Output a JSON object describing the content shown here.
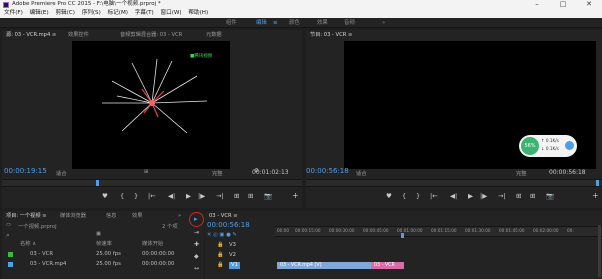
{
  "app": {
    "title": "Adobe Premiere Pro CC 2015 - F:\\电脑\\一个视频.prproj *",
    "window_controls": {
      "minimize": "–",
      "maximize": "□",
      "close": "✕"
    }
  },
  "menu": [
    "文件(F)",
    "编辑(E)",
    "剪辑(C)",
    "序列(S)",
    "标记(M)",
    "字幕(T)",
    "窗口(W)",
    "帮助(H)"
  ],
  "workspaces": {
    "items": [
      "组件",
      "编辑",
      "颜色",
      "效果",
      "音频"
    ],
    "active_suffix": "≡",
    "more": "»"
  },
  "source_panel": {
    "tabs": [
      "源: 03 - VCR.mp4 ≡",
      "效果控件",
      "音频剪辑混合器: 03 - VCR",
      "元数据"
    ],
    "watermark": "■腾讯视频",
    "timecode": "00:00:19:15",
    "fit": "适合",
    "quality": "完整",
    "duration": "00:01:02:13"
  },
  "program_panel": {
    "tab": "节目: 03 - VCR ≡",
    "timecode": "00:00:56:18",
    "fit": "适合",
    "quality": "完整",
    "duration": "00:00:56:18",
    "overlay": {
      "percent": "56%",
      "up": "↑ 0.1K/s",
      "down": "↓ 0.1K/s"
    }
  },
  "transport_glyphs": [
    "♥",
    "{",
    "}",
    "|←",
    "◀|",
    "▶",
    "|▶",
    "→|",
    "⊞",
    "⊞",
    "📷",
    "+"
  ],
  "project_panel": {
    "tabs": [
      "项目: 一个视频 ≡",
      "媒体浏览器",
      "信息",
      "效果"
    ],
    "project_file": "一个视频.prproj",
    "count": "2 个项",
    "columns": [
      "名称 ∧",
      "帧速率",
      "媒体开始"
    ],
    "items": [
      {
        "name": "03 - VCR",
        "fps": "25.00 fps",
        "start": "00:00:00:00",
        "color": "#3fb83f"
      },
      {
        "name": "03 - VCR.mp4",
        "fps": "25.00 fps",
        "start": "00:00:00:00",
        "color": "#4f9fe6"
      }
    ]
  },
  "timeline": {
    "tab": "03 - VCR ≡",
    "timecode": "00:00:56:18",
    "ruler": [
      "00:00",
      "00:00:15:00",
      "00:00:30:00",
      "00:00:45:00",
      "00:01:00:00",
      "00:01:15:00",
      "00:01:30:00",
      "00:01:45:00",
      "00:02:00:00",
      "00:"
    ],
    "tracks": [
      "V3",
      "V2",
      "V1"
    ],
    "clips": [
      {
        "label": "03 - VCR.mp4 [V]",
        "color": "#4f9fe6"
      },
      {
        "label": "03 - VCR",
        "color": "#e06cb0"
      }
    ]
  },
  "colors": {
    "accent": "#4f9fe6",
    "highlight_circle": "#e02020"
  }
}
